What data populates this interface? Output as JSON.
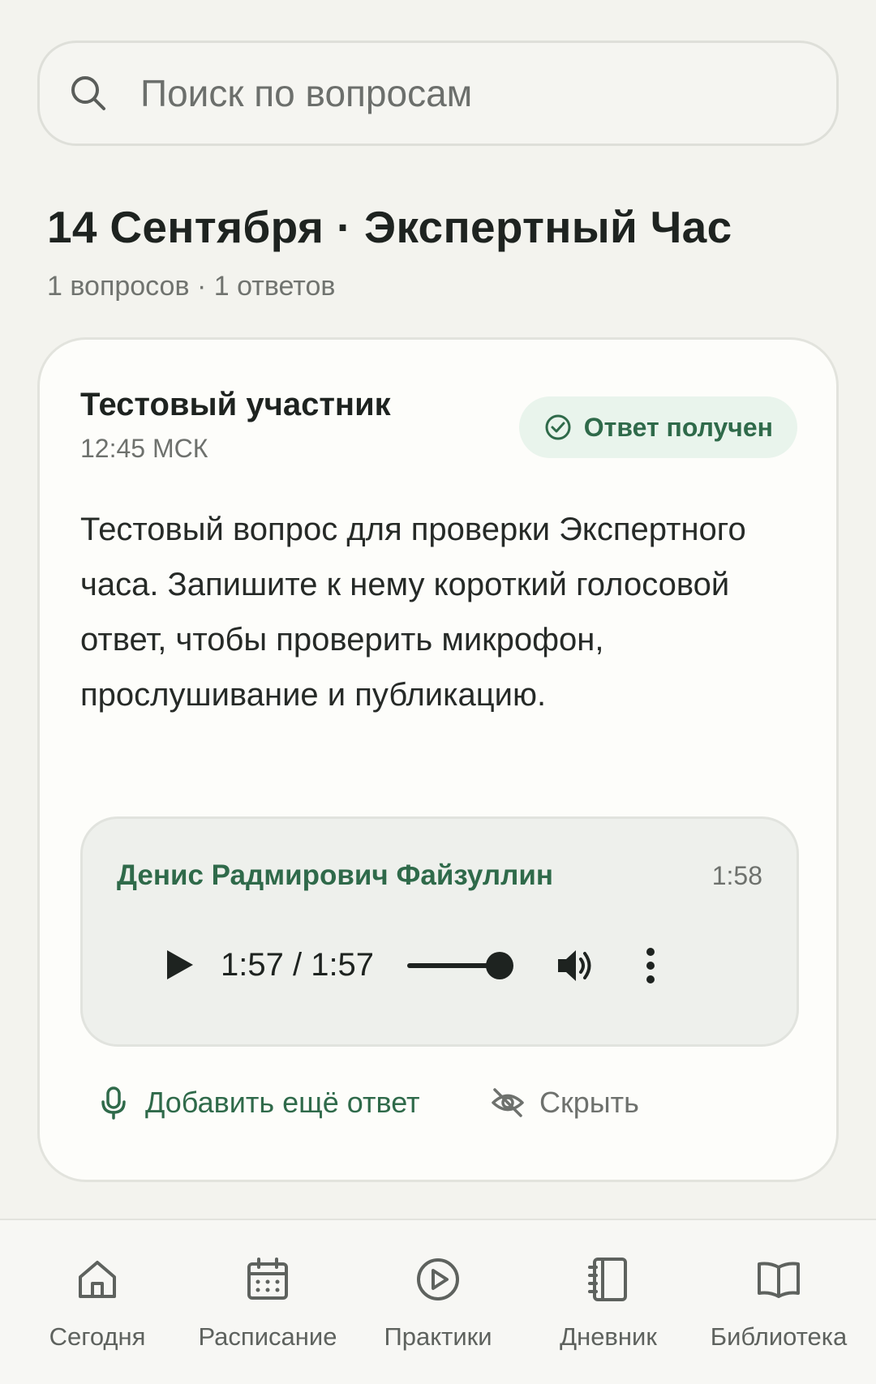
{
  "search": {
    "placeholder": "Поиск по вопросам",
    "icon": "search-icon"
  },
  "section": {
    "title": "14 Сентября · Экспертный Час",
    "subtitle": "1 вопросов · 1 ответов"
  },
  "card": {
    "author": "Тестовый участник",
    "time": "12:45 МСК",
    "badge": "Ответ получен",
    "question": "Тестовый вопрос для проверки Экспертного часа. Запишите к нему короткий голосовой ответ, чтобы проверить микрофон, прослушивание и публикацию.",
    "answer": {
      "author": "Денис Радмирович Файзуллин",
      "duration": "1:58",
      "player_time": "1:57 / 1:57",
      "progress": 1.0
    },
    "actions": {
      "add": "Добавить ещё ответ",
      "hide": "Скрыть"
    }
  },
  "nav": {
    "items": [
      {
        "label": "Сегодня",
        "icon": "home-icon"
      },
      {
        "label": "Расписание",
        "icon": "calendar-icon"
      },
      {
        "label": "Практики",
        "icon": "play-circle-icon"
      },
      {
        "label": "Дневник",
        "icon": "notebook-icon"
      },
      {
        "label": "Библиотека",
        "icon": "book-icon"
      }
    ]
  },
  "colors": {
    "accent": "#2f6a4a",
    "background": "#f3f3ee",
    "card": "#fdfdfa"
  }
}
